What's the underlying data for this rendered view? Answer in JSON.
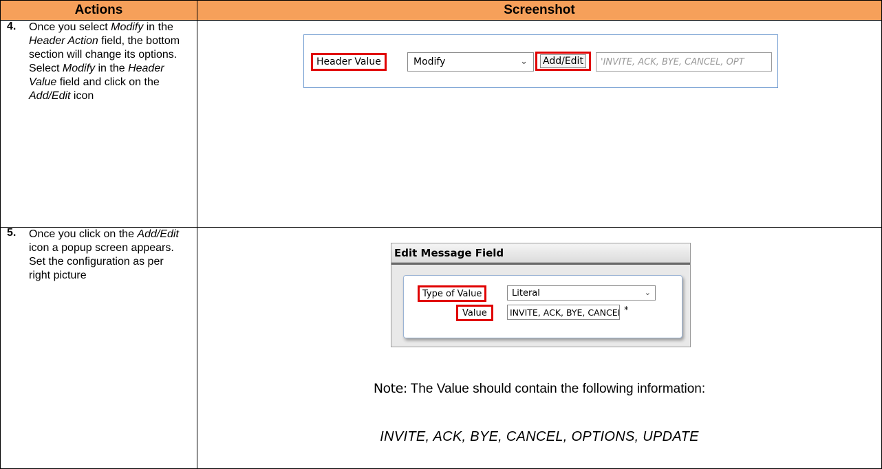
{
  "table": {
    "header_actions": "Actions",
    "header_screenshot": "Screenshot"
  },
  "rows": [
    {
      "number": "4.",
      "text_html": "Once you select <i>Modify</i> in the <i>Header Action</i> field, the bottom section will change its options.<br>Select <i>Modify</i> in the <i>Header Value</i> field and click on the <i>Add/Edit</i> icon"
    },
    {
      "number": "5.",
      "text_html": "Once you click on the <i>Add/Edit</i> icon a popup screen appears.<br>Set the configuration as per right picture"
    }
  ],
  "shot1": {
    "label": "Header Value",
    "select_value": "Modify",
    "button_label": "Add/Edit",
    "value_placeholder": "'INVITE, ACK, BYE, CANCEL, OPT"
  },
  "shot2": {
    "title": "Edit Message Field",
    "type_label": "Type of Value",
    "type_value": "Literal",
    "value_label": "Value",
    "value_text": "INVITE, ACK, BYE, CANCEL,",
    "required_mark": "*"
  },
  "note": {
    "prefix": "Note:",
    "text": " The Value should contain the following information:",
    "list": "INVITE, ACK, BYE, CANCEL, OPTIONS, UPDATE"
  },
  "colors": {
    "header_bg": "#F6A05A",
    "highlight": "#E00000"
  }
}
